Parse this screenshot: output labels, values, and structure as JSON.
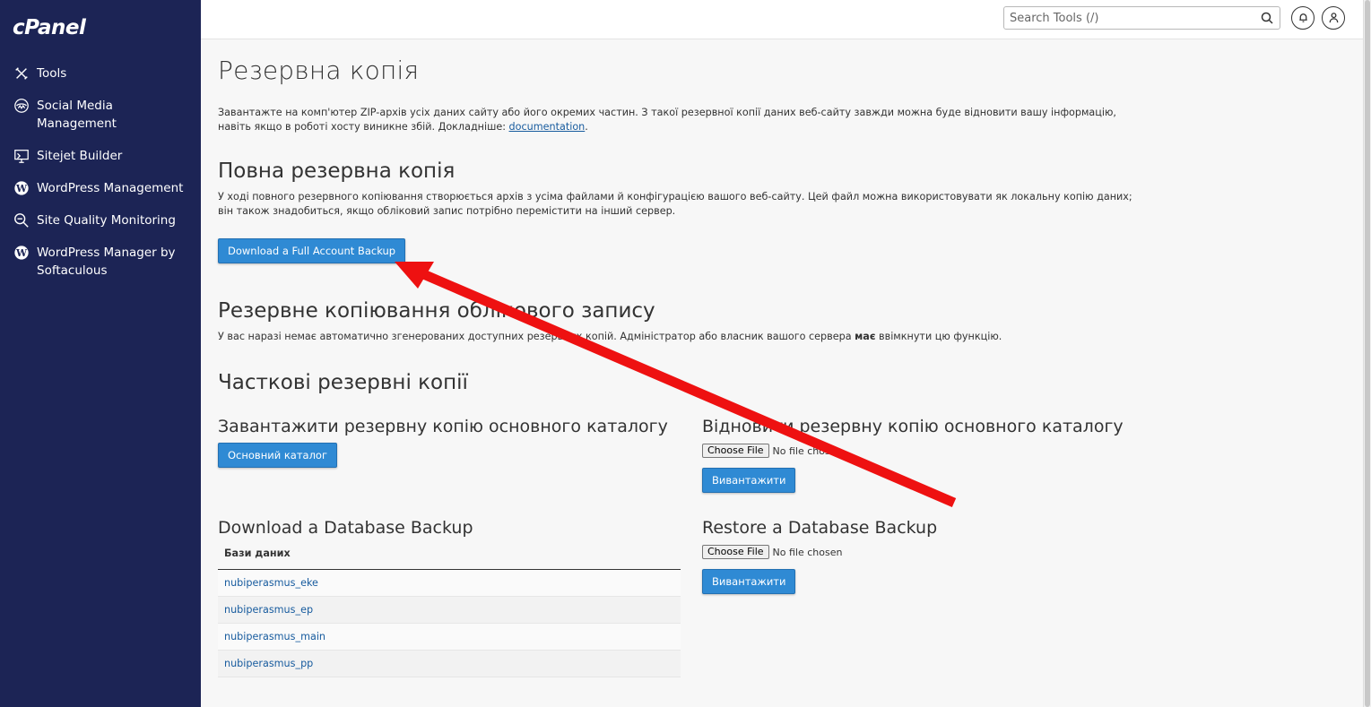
{
  "sidebar": {
    "logo": "cPanel",
    "items": [
      {
        "label": "Tools",
        "icon": "tools-icon"
      },
      {
        "label": "Social Media Management",
        "icon": "social-media-icon"
      },
      {
        "label": "Sitejet Builder",
        "icon": "sitejet-icon"
      },
      {
        "label": "WordPress Management",
        "icon": "wordpress-icon"
      },
      {
        "label": "Site Quality Monitoring",
        "icon": "magnifier-icon"
      },
      {
        "label": "WordPress Manager by Softaculous",
        "icon": "wordpress-icon"
      }
    ]
  },
  "topbar": {
    "search_placeholder": "Search Tools (/)"
  },
  "page": {
    "title": "Резервна копія",
    "intro": "Завантажте на комп'ютер ZIP-архів усіх даних сайту або його окремих частин. З такої резервної копії даних веб-сайту завжди можна буде відновити вашу інформацію, навіть якщо в роботі хосту виникне збій. Докладніше: ",
    "intro_link": "documentation",
    "intro_end": "."
  },
  "full_backup": {
    "heading": "Повна резервна копія",
    "description": "У ході повного резервного копіювання створюється архів з усіма файлами й конфігурацією вашого веб-сайту. Цей файл можна використовувати як локальну копію даних; він також знадобиться, якщо обліковий запис потрібно перемістити на інший сервер.",
    "button": "Download a Full Account Backup"
  },
  "account_backup": {
    "heading": "Резервне копіювання облікового запису",
    "description_start": "У вас наразі немає автоматично згенерованих доступних резервних копій. Адміністратор або власник вашого сервера ",
    "description_bold": "має",
    "description_end": " ввімкнути цю функцію."
  },
  "partial": {
    "heading": "Часткові резервні копії",
    "home_download": {
      "heading": "Завантажити резервну копію основного каталогу",
      "button": "Основний каталог"
    },
    "home_restore": {
      "heading": "Відновити резервну копію основного каталогу",
      "choose_file": "Choose File",
      "no_file": "No file chosen",
      "button": "Вивантажити"
    },
    "db_download": {
      "heading": "Download a Database Backup",
      "column": "Бази даних",
      "rows": [
        "nubiperasmus_eke",
        "nubiperasmus_ep",
        "nubiperasmus_main",
        "nubiperasmus_pp"
      ]
    },
    "db_restore": {
      "heading": "Restore a Database Backup",
      "choose_file": "Choose File",
      "no_file": "No file chosen",
      "button": "Вивантажити"
    }
  },
  "colors": {
    "sidebar": "#1c2455",
    "button": "#2f8ad4",
    "link": "#175b9e",
    "annotation": "#ee1111"
  }
}
